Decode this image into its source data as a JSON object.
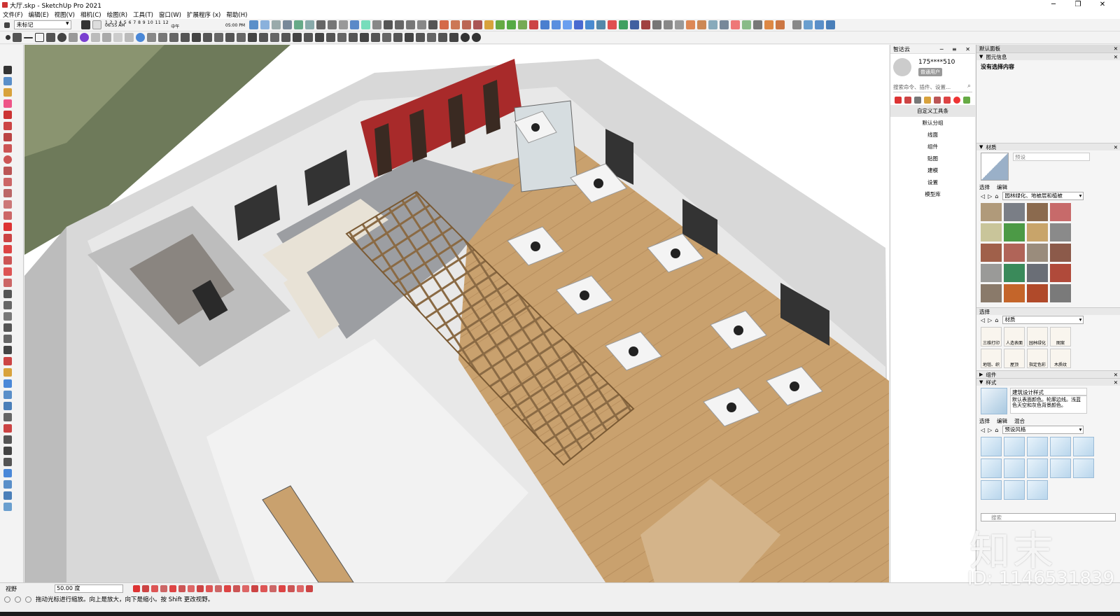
{
  "window": {
    "title": "大厅.skp - SketchUp Pro 2021",
    "minimize": "─",
    "maximize": "❐",
    "close": "✕"
  },
  "menu": [
    "文件(F)",
    "编辑(E)",
    "视图(V)",
    "相机(C)",
    "绘图(R)",
    "工具(T)",
    "窗口(W)",
    "扩展程序 (x)",
    "帮助(H)"
  ],
  "toolbar": {
    "tag_value": "未标记",
    "shadow_numbers": "1 2 3 4 5 6 7 8 9 10 11 12",
    "shadow_time_start": "06:55 AM",
    "shadow_time_mid": "中午",
    "shadow_time_end": "05:00 PM"
  },
  "plugin": {
    "title": "智达云",
    "user": "175****510",
    "user_badge": "普通用户",
    "search_placeholder": "搜索命令、插件、设置...",
    "menu": [
      "自定义工具条",
      "默认分组",
      "线面",
      "组件",
      "贴图",
      "建模",
      "设置",
      "模型库"
    ]
  },
  "tray": {
    "title": "默认面板",
    "entity_info": {
      "header": "图元信息",
      "text": "没有选择内容"
    },
    "materials": {
      "header": "材质",
      "default_label": "预设",
      "tab_select": "选择",
      "tab_edit": "编辑",
      "library": "园林绿化、地被层和植被",
      "swatch_colors": [
        "#b09a7a",
        "#7a7e86",
        "#8b6a4e",
        "#c76a6a",
        "#c9c59a",
        "#4c9a46",
        "#c8a46a",
        "#8a8a8a",
        "#a0604a",
        "#b06458",
        "#9a8c7c",
        "#8c5a4a",
        "#9a9a98",
        "#3a8a5a",
        "#6a6e76",
        "#b04a3a",
        "#8a7a6a",
        "#c4652a",
        "#b04a2a",
        "#7a7a7a"
      ]
    },
    "select_section": {
      "header": "选择",
      "library": "材质",
      "items": [
        "三维打印",
        "人造表面",
        "园林绿化",
        "图案",
        "地毯、织",
        "屋顶",
        "指定色彩",
        "木质纹"
      ]
    },
    "components": {
      "header": "组件"
    },
    "styles": {
      "header": "样式",
      "style_name": "建筑设计样式",
      "style_desc": "默认表面颜色。轮廓边线。浅蓝色天空和灰色背景颜色。",
      "tab_select": "选择",
      "tab_edit": "编辑",
      "tab_mix": "混合",
      "library": "预设风格",
      "search_placeholder": "搜索"
    }
  },
  "status": {
    "measure_label": "视野",
    "measure_value": "50.00 度",
    "hint": "拖动光标进行缩放。向上是放大，向下是缩小。按 Shift 更改视野。"
  },
  "watermark": {
    "id": "ID: 1146531839",
    "logo": "知末"
  }
}
